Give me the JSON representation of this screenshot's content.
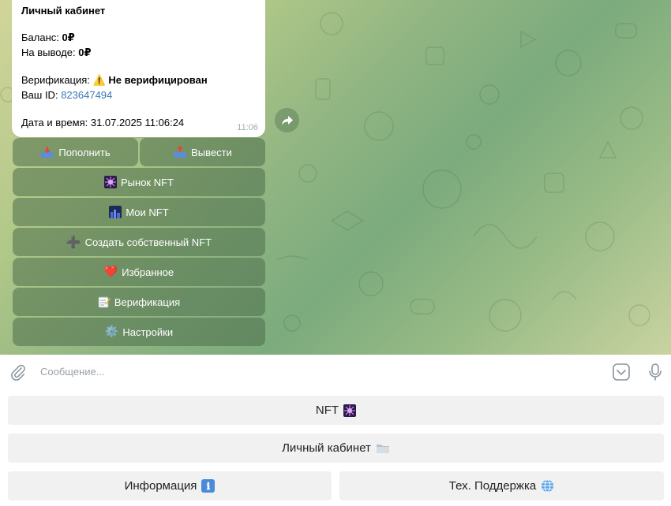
{
  "message": {
    "title": "Личный кабинет",
    "balance_label": "Баланс:",
    "balance_value": "0₽",
    "withdraw_label": "На выводе:",
    "withdraw_value": "0₽",
    "verification_label": "Верификация:",
    "verification_icon": "⚠️",
    "verification_value": "Не верифицирован",
    "id_label": "Ваш ID:",
    "id_value": "823647494",
    "datetime": "Дата и время: 31.07.2025 11:06:24",
    "time": "11:06"
  },
  "inline_keyboard": {
    "deposit": {
      "icon": "inbox-tray-icon",
      "label": "Пополнить"
    },
    "withdraw": {
      "icon": "outbox-tray-icon",
      "label": "Вывести"
    },
    "market": {
      "icon": "sparkler-icon",
      "label": "Рынок NFT"
    },
    "my_nft": {
      "icon": "night-city-icon",
      "label": "Мои NFT"
    },
    "create": {
      "icon": "plus-icon",
      "glyph": "➕",
      "label": "Создать собственный NFT"
    },
    "favorites": {
      "icon": "heart-icon",
      "glyph": "❤️",
      "label": "Избранное"
    },
    "verification": {
      "icon": "memo-icon",
      "label": "Верификация"
    },
    "settings": {
      "icon": "gear-icon",
      "glyph": "⚙️",
      "label": "Настройки"
    }
  },
  "compose": {
    "placeholder": "Сообщение..."
  },
  "reply_keyboard": {
    "nft": {
      "label": "NFT",
      "icon": "sparkler-icon"
    },
    "account": {
      "label": "Личный кабинет",
      "icon": "folder-icon"
    },
    "info": {
      "label": "Информация",
      "icon": "info-icon",
      "glyph": "ℹ"
    },
    "support": {
      "label": "Тех. Поддержка",
      "icon": "globe-icon"
    }
  },
  "colors": {
    "bubble": "#ffffff",
    "link": "#3a79b5",
    "inline_button": "#4c6d4a",
    "reply_button": "#f1f1f1"
  }
}
